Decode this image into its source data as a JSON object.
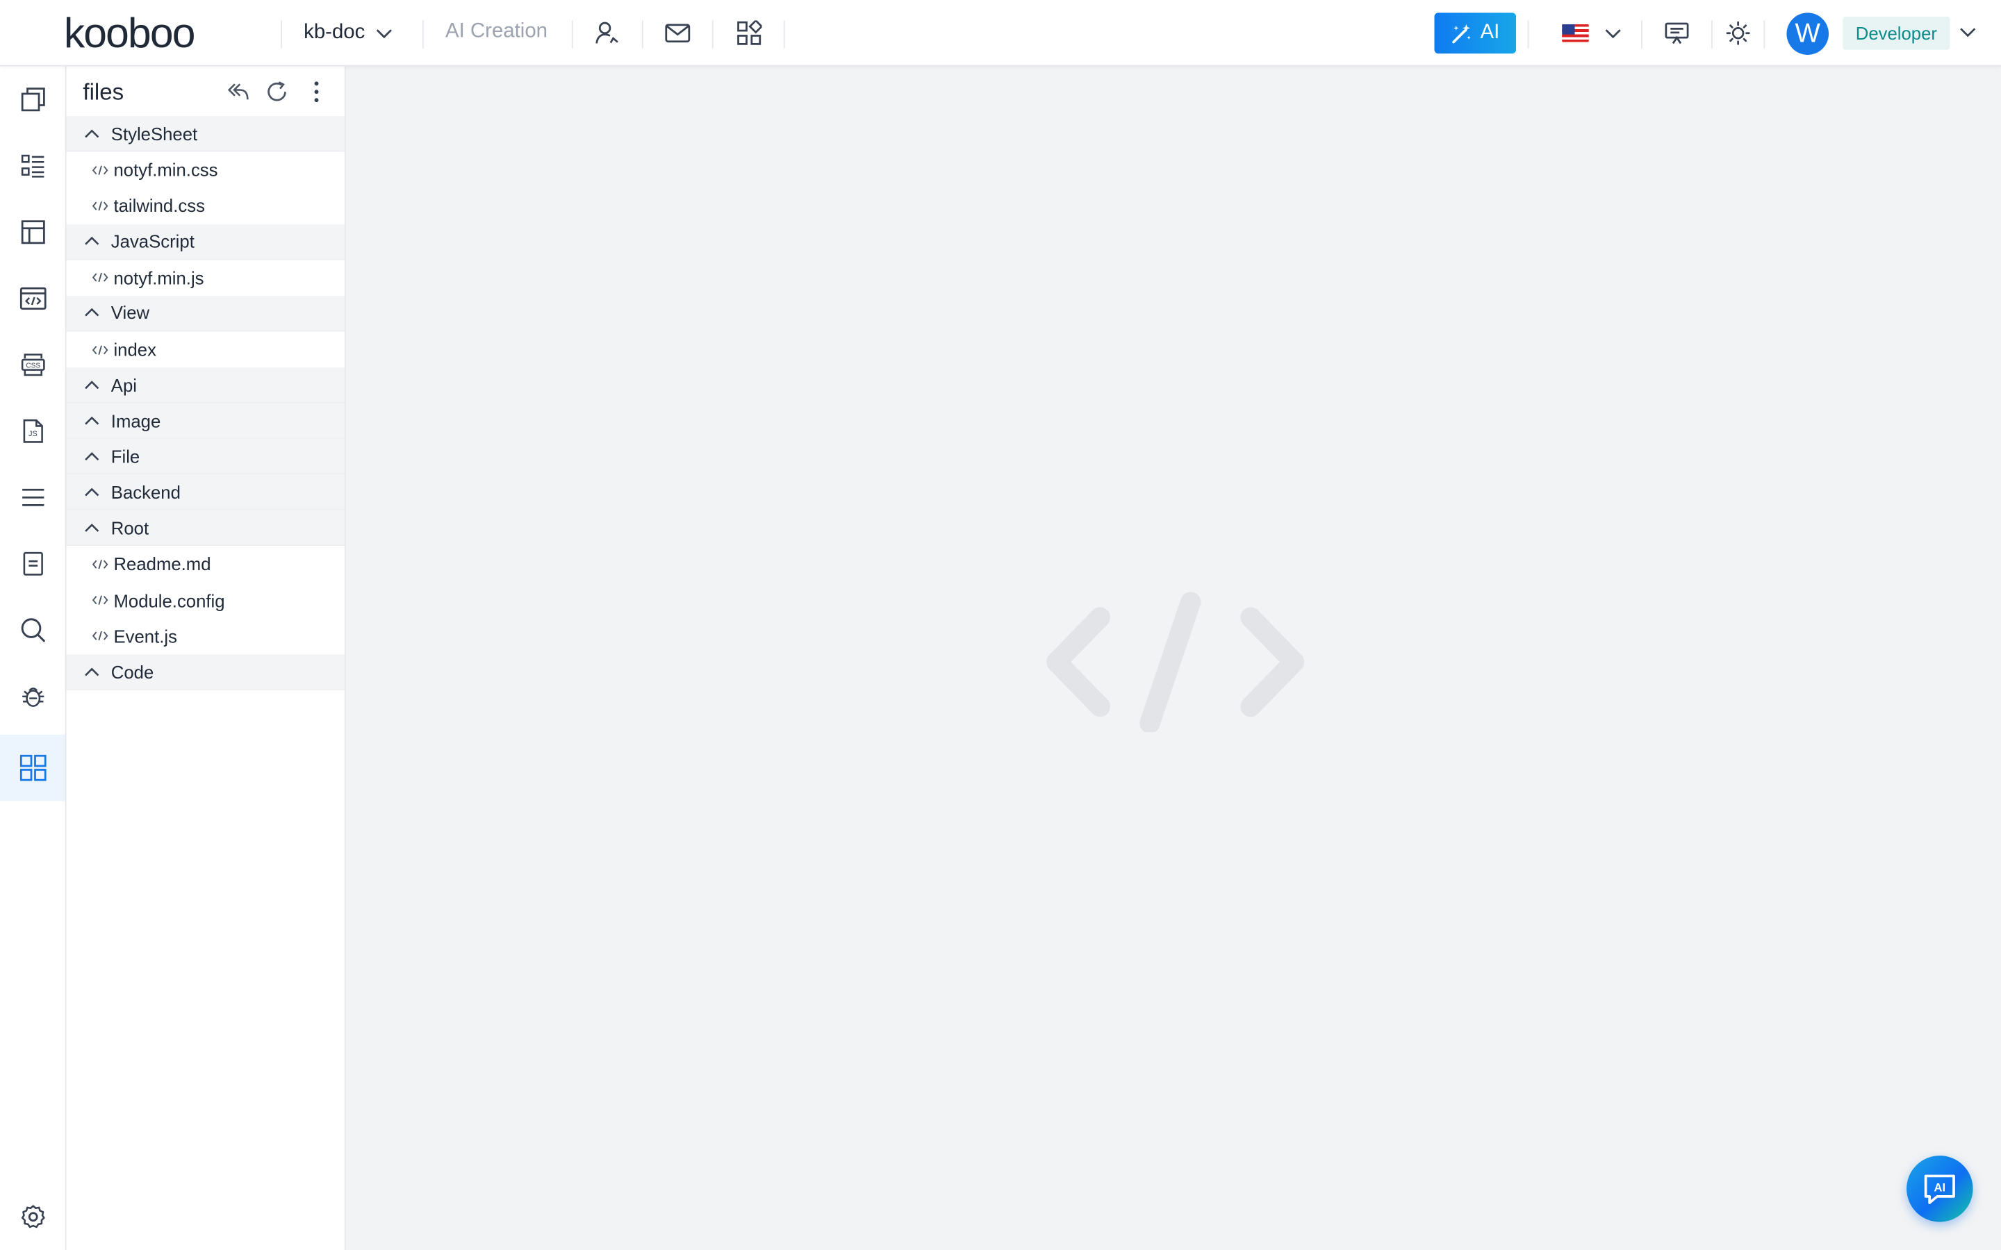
{
  "header": {
    "logo": "kooboo",
    "site": "kb-doc",
    "ai_creation": "AI Creation",
    "ai_button": "AI",
    "user_initial": "W",
    "role": "Developer"
  },
  "panel": {
    "title": "files",
    "groups": [
      {
        "label": "StyleSheet",
        "files": [
          "notyf.min.css",
          "tailwind.css"
        ]
      },
      {
        "label": "JavaScript",
        "files": [
          "notyf.min.js"
        ]
      },
      {
        "label": "View",
        "files": [
          "index"
        ]
      },
      {
        "label": "Api",
        "files": []
      },
      {
        "label": "Image",
        "files": []
      },
      {
        "label": "File",
        "files": []
      },
      {
        "label": "Backend",
        "files": []
      },
      {
        "label": "Root",
        "files": [
          "Readme.md",
          "Module.config",
          "Event.js"
        ]
      },
      {
        "label": "Code",
        "files": []
      }
    ]
  },
  "fab": {
    "label": "AI"
  },
  "colors": {
    "accent": "#1778e8",
    "role_bg": "#e8f4f4",
    "role_text": "#0d8b8b",
    "main_bg": "#f2f3f4"
  }
}
